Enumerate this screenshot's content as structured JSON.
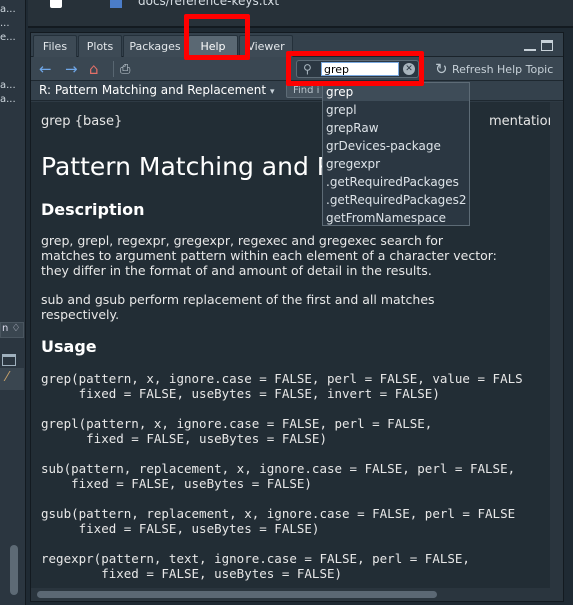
{
  "left_gutter": {
    "snippets": [
      "a...",
      "...",
      "e...",
      "a...",
      "a..."
    ],
    "dropdown_label": "n ♢"
  },
  "files": {
    "visible_file": "docs/reference-keys.txt"
  },
  "pane": {
    "tabs": [
      {
        "label": "Files",
        "active": false
      },
      {
        "label": "Plots",
        "active": false
      },
      {
        "label": "Packages",
        "active": false
      },
      {
        "label": "Help",
        "active": true
      },
      {
        "label": "Viewer",
        "active": false
      }
    ]
  },
  "toolbar": {
    "back_icon": "←",
    "forward_icon": "→",
    "home_icon": "⌂",
    "print_icon": "⎙",
    "search_value": "grep",
    "refresh_label": "Refresh Help Topic"
  },
  "topic_bar": {
    "topic": "R: Pattern Matching and Replacement",
    "find_placeholder": "Find i"
  },
  "autocomplete": {
    "items": [
      "grep",
      "grepl",
      "grepRaw",
      "grDevices-package",
      "gregexpr",
      ".getRequiredPackages",
      ".getRequiredPackages2",
      "getFromNamespace"
    ],
    "selected_index": 0
  },
  "doc": {
    "package_line": "grep {base}",
    "right_header_tail": "mentation",
    "title": "Pattern Matching and R",
    "description_heading": "Description",
    "description_lines": [
      "grep, grepl, regexpr, gregexpr, regexec and gregexec search for",
      "matches to argument pattern within each element of a character vector:",
      "they differ in the format of and amount of detail in the results."
    ],
    "sub_lines": [
      "sub and gsub perform replacement of the first and all matches",
      "respectively."
    ],
    "usage_heading": "Usage",
    "usage_lines": [
      "grep(pattern, x, ignore.case = FALSE, perl = FALSE, value = FALS",
      "     fixed = FALSE, useBytes = FALSE, invert = FALSE)",
      "",
      "grepl(pattern, x, ignore.case = FALSE, perl = FALSE,",
      "      fixed = FALSE, useBytes = FALSE)",
      "",
      "sub(pattern, replacement, x, ignore.case = FALSE, perl = FALSE,",
      "    fixed = FALSE, useBytes = FALSE)",
      "",
      "gsub(pattern, replacement, x, ignore.case = FALSE, perl = FALSE",
      "     fixed = FALSE, useBytes = FALSE)",
      "",
      "regexpr(pattern, text, ignore.case = FALSE, perl = FALSE,",
      "        fixed = FALSE, useBytes = FALSE)"
    ]
  },
  "colors": {
    "highlight": "#ff0000",
    "background": "#222d35",
    "accent": "#6fa7e8"
  }
}
